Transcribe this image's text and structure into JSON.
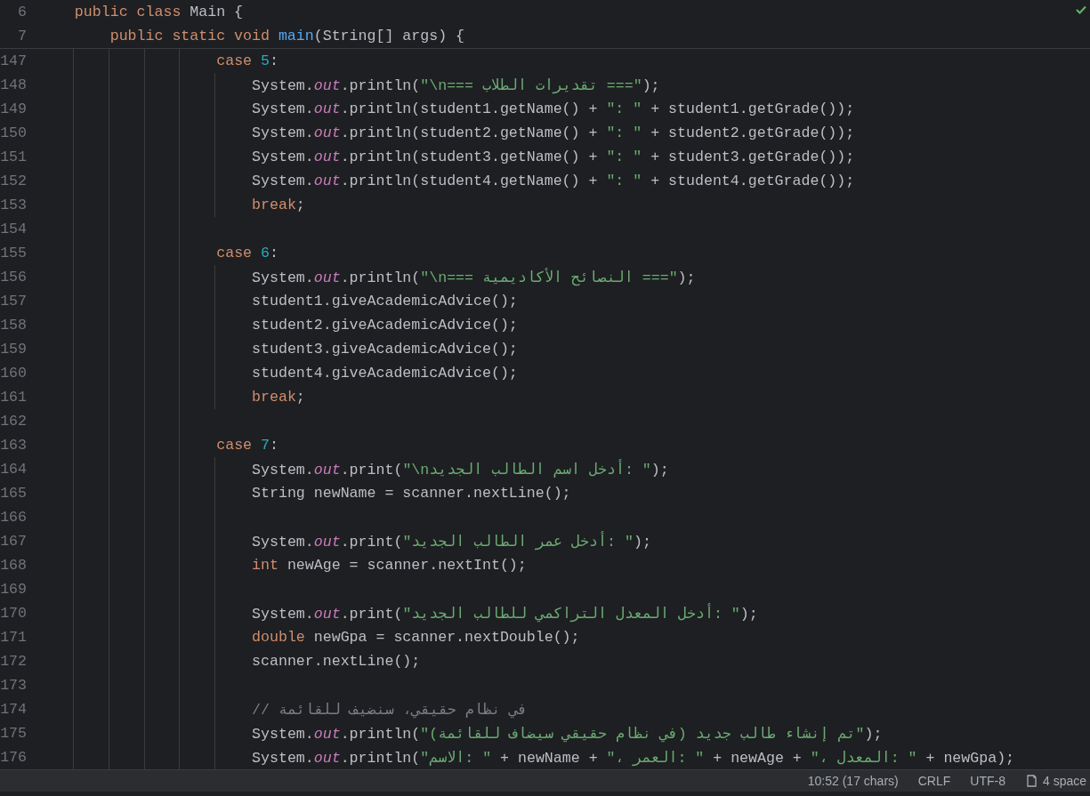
{
  "sticky_header": [
    {
      "number": "6",
      "tokens": [
        {
          "kind": "kw",
          "text": "    public class "
        },
        {
          "kind": "txt",
          "text": "Main {"
        }
      ]
    },
    {
      "number": "7",
      "tokens": [
        {
          "kind": "kw",
          "text": "        public static void "
        },
        {
          "kind": "fn",
          "text": "main"
        },
        {
          "kind": "txt",
          "text": "(String[] args) {"
        }
      ]
    }
  ],
  "lines": [
    {
      "number": "147",
      "tokens": [
        {
          "kind": "kw",
          "text": "                    case "
        },
        {
          "kind": "num",
          "text": "5"
        },
        {
          "kind": "txt",
          "text": ":"
        }
      ]
    },
    {
      "number": "148",
      "tokens": [
        {
          "kind": "txt",
          "text": "                        System."
        },
        {
          "kind": "fld",
          "text": "out"
        },
        {
          "kind": "txt",
          "text": ".println("
        },
        {
          "kind": "str",
          "text": "\"\\n=== تقديرات الطلاب ===\""
        },
        {
          "kind": "txt",
          "text": ");"
        }
      ]
    },
    {
      "number": "149",
      "tokens": [
        {
          "kind": "txt",
          "text": "                        System."
        },
        {
          "kind": "fld",
          "text": "out"
        },
        {
          "kind": "txt",
          "text": ".println(student1.getName() + "
        },
        {
          "kind": "str",
          "text": "\": \""
        },
        {
          "kind": "txt",
          "text": " + student1.getGrade());"
        }
      ]
    },
    {
      "number": "150",
      "tokens": [
        {
          "kind": "txt",
          "text": "                        System."
        },
        {
          "kind": "fld",
          "text": "out"
        },
        {
          "kind": "txt",
          "text": ".println(student2.getName() + "
        },
        {
          "kind": "str",
          "text": "\": \""
        },
        {
          "kind": "txt",
          "text": " + student2.getGrade());"
        }
      ]
    },
    {
      "number": "151",
      "tokens": [
        {
          "kind": "txt",
          "text": "                        System."
        },
        {
          "kind": "fld",
          "text": "out"
        },
        {
          "kind": "txt",
          "text": ".println(student3.getName() + "
        },
        {
          "kind": "str",
          "text": "\": \""
        },
        {
          "kind": "txt",
          "text": " + student3.getGrade());"
        }
      ]
    },
    {
      "number": "152",
      "tokens": [
        {
          "kind": "txt",
          "text": "                        System."
        },
        {
          "kind": "fld",
          "text": "out"
        },
        {
          "kind": "txt",
          "text": ".println(student4.getName() + "
        },
        {
          "kind": "str",
          "text": "\": \""
        },
        {
          "kind": "txt",
          "text": " + student4.getGrade());"
        }
      ]
    },
    {
      "number": "153",
      "tokens": [
        {
          "kind": "kw",
          "text": "                        break"
        },
        {
          "kind": "txt",
          "text": ";"
        }
      ]
    },
    {
      "number": "154"
    },
    {
      "number": "155",
      "tokens": [
        {
          "kind": "kw",
          "text": "                    case "
        },
        {
          "kind": "num",
          "text": "6"
        },
        {
          "kind": "txt",
          "text": ":"
        }
      ]
    },
    {
      "number": "156",
      "tokens": [
        {
          "kind": "txt",
          "text": "                        System."
        },
        {
          "kind": "fld",
          "text": "out"
        },
        {
          "kind": "txt",
          "text": ".println("
        },
        {
          "kind": "str",
          "text": "\"\\n=== النصائح الأكاديمية ===\""
        },
        {
          "kind": "txt",
          "text": ");"
        }
      ]
    },
    {
      "number": "157",
      "tokens": [
        {
          "kind": "txt",
          "text": "                        student1.giveAcademicAdvice();"
        }
      ]
    },
    {
      "number": "158",
      "tokens": [
        {
          "kind": "txt",
          "text": "                        student2.giveAcademicAdvice();"
        }
      ]
    },
    {
      "number": "159",
      "tokens": [
        {
          "kind": "txt",
          "text": "                        student3.giveAcademicAdvice();"
        }
      ]
    },
    {
      "number": "160",
      "tokens": [
        {
          "kind": "txt",
          "text": "                        student4.giveAcademicAdvice();"
        }
      ]
    },
    {
      "number": "161",
      "tokens": [
        {
          "kind": "kw",
          "text": "                        break"
        },
        {
          "kind": "txt",
          "text": ";"
        }
      ]
    },
    {
      "number": "162"
    },
    {
      "number": "163",
      "tokens": [
        {
          "kind": "kw",
          "text": "                    case "
        },
        {
          "kind": "num",
          "text": "7"
        },
        {
          "kind": "txt",
          "text": ":"
        }
      ]
    },
    {
      "number": "164",
      "tokens": [
        {
          "kind": "txt",
          "text": "                        System."
        },
        {
          "kind": "fld",
          "text": "out"
        },
        {
          "kind": "txt",
          "text": ".print("
        },
        {
          "kind": "str",
          "text": "\"\\nأدخل اسم الطالب الجديد: \""
        },
        {
          "kind": "txt",
          "text": ");"
        }
      ]
    },
    {
      "number": "165",
      "tokens": [
        {
          "kind": "txt",
          "text": "                        String newName = scanner.nextLine();"
        }
      ]
    },
    {
      "number": "166"
    },
    {
      "number": "167",
      "tokens": [
        {
          "kind": "txt",
          "text": "                        System."
        },
        {
          "kind": "fld",
          "text": "out"
        },
        {
          "kind": "txt",
          "text": ".print("
        },
        {
          "kind": "str",
          "text": "\"أدخل عمر الطالب الجديد: \""
        },
        {
          "kind": "txt",
          "text": ");"
        }
      ]
    },
    {
      "number": "168",
      "tokens": [
        {
          "kind": "kw",
          "text": "                        int "
        },
        {
          "kind": "txt",
          "text": "newAge = scanner.nextInt();"
        }
      ]
    },
    {
      "number": "169"
    },
    {
      "number": "170",
      "tokens": [
        {
          "kind": "txt",
          "text": "                        System."
        },
        {
          "kind": "fld",
          "text": "out"
        },
        {
          "kind": "txt",
          "text": ".print("
        },
        {
          "kind": "str",
          "text": "\"أدخل المعدل التراكمي للطالب الجديد: \""
        },
        {
          "kind": "txt",
          "text": ");"
        }
      ]
    },
    {
      "number": "171",
      "tokens": [
        {
          "kind": "kw",
          "text": "                        double "
        },
        {
          "kind": "txt",
          "text": "newGpa = scanner.nextDouble();"
        }
      ]
    },
    {
      "number": "172",
      "tokens": [
        {
          "kind": "txt",
          "text": "                        scanner.nextLine();"
        }
      ]
    },
    {
      "number": "173"
    },
    {
      "number": "174",
      "tokens": [
        {
          "kind": "cmt",
          "text": "                        // في نظام حقيقي، سنضيف للقائمة"
        }
      ]
    },
    {
      "number": "175",
      "tokens": [
        {
          "kind": "txt",
          "text": "                        System."
        },
        {
          "kind": "fld",
          "text": "out"
        },
        {
          "kind": "txt",
          "text": ".println("
        },
        {
          "kind": "str",
          "text": "\"تم إنشاء طالب جديد (في نظام حقيقي سيضاف للقائمة)\""
        },
        {
          "kind": "txt",
          "text": ");"
        }
      ]
    },
    {
      "number": "176",
      "tokens": [
        {
          "kind": "txt",
          "text": "                        System."
        },
        {
          "kind": "fld",
          "text": "out"
        },
        {
          "kind": "txt",
          "text": ".println("
        },
        {
          "kind": "str",
          "text": "\"الاسم: \""
        },
        {
          "kind": "txt",
          "text": " + newName + "
        },
        {
          "kind": "str",
          "text": "\"، العمر: \""
        },
        {
          "kind": "txt",
          "text": " + newAge + "
        },
        {
          "kind": "str",
          "text": "\"، المعدل: \""
        },
        {
          "kind": "txt",
          "text": " + newGpa);"
        }
      ]
    }
  ],
  "status_bar": [
    {
      "kind": "text",
      "label": "10:52 (17 chars)"
    },
    {
      "kind": "text",
      "label": "CRLF"
    },
    {
      "kind": "text",
      "label": "UTF-8"
    },
    {
      "kind": "indent",
      "label": "4 space"
    }
  ]
}
